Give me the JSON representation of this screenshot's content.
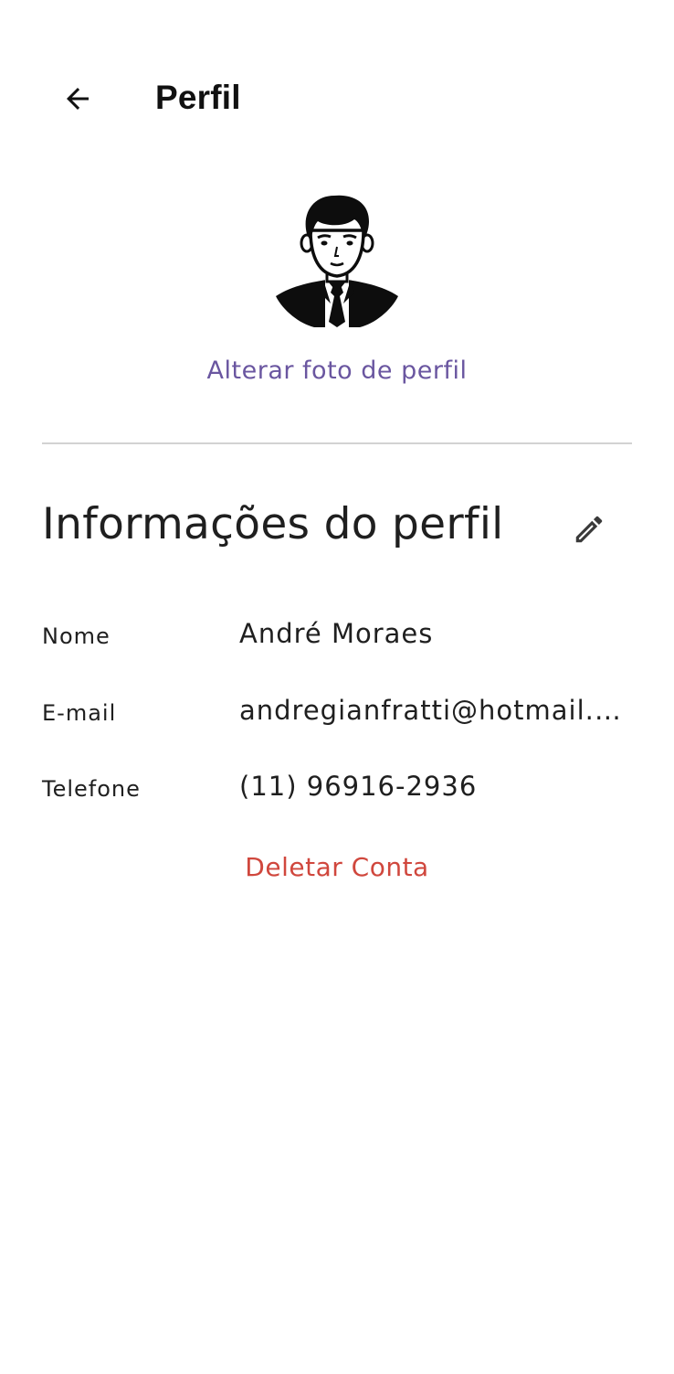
{
  "header": {
    "title": "Perfil",
    "back_icon": "arrow-back-icon"
  },
  "avatar": {
    "icon": "user-avatar-icon",
    "change_photo_label": "Alterar foto de perfil"
  },
  "profile_info": {
    "section_title": "Informações do perfil",
    "edit_icon": "pencil-icon",
    "fields": [
      {
        "label": "Nome",
        "value": "André Moraes"
      },
      {
        "label": "E-mail",
        "value": "andregianfratti@hotmail.com"
      },
      {
        "label": "Telefone",
        "value": "(11) 96916-2936"
      }
    ]
  },
  "actions": {
    "delete_account_label": "Deletar Conta"
  },
  "colors": {
    "accent": "#6a56a0",
    "danger": "#d0473d",
    "text": "#1f1f1f",
    "divider": "#d2d2d2"
  }
}
